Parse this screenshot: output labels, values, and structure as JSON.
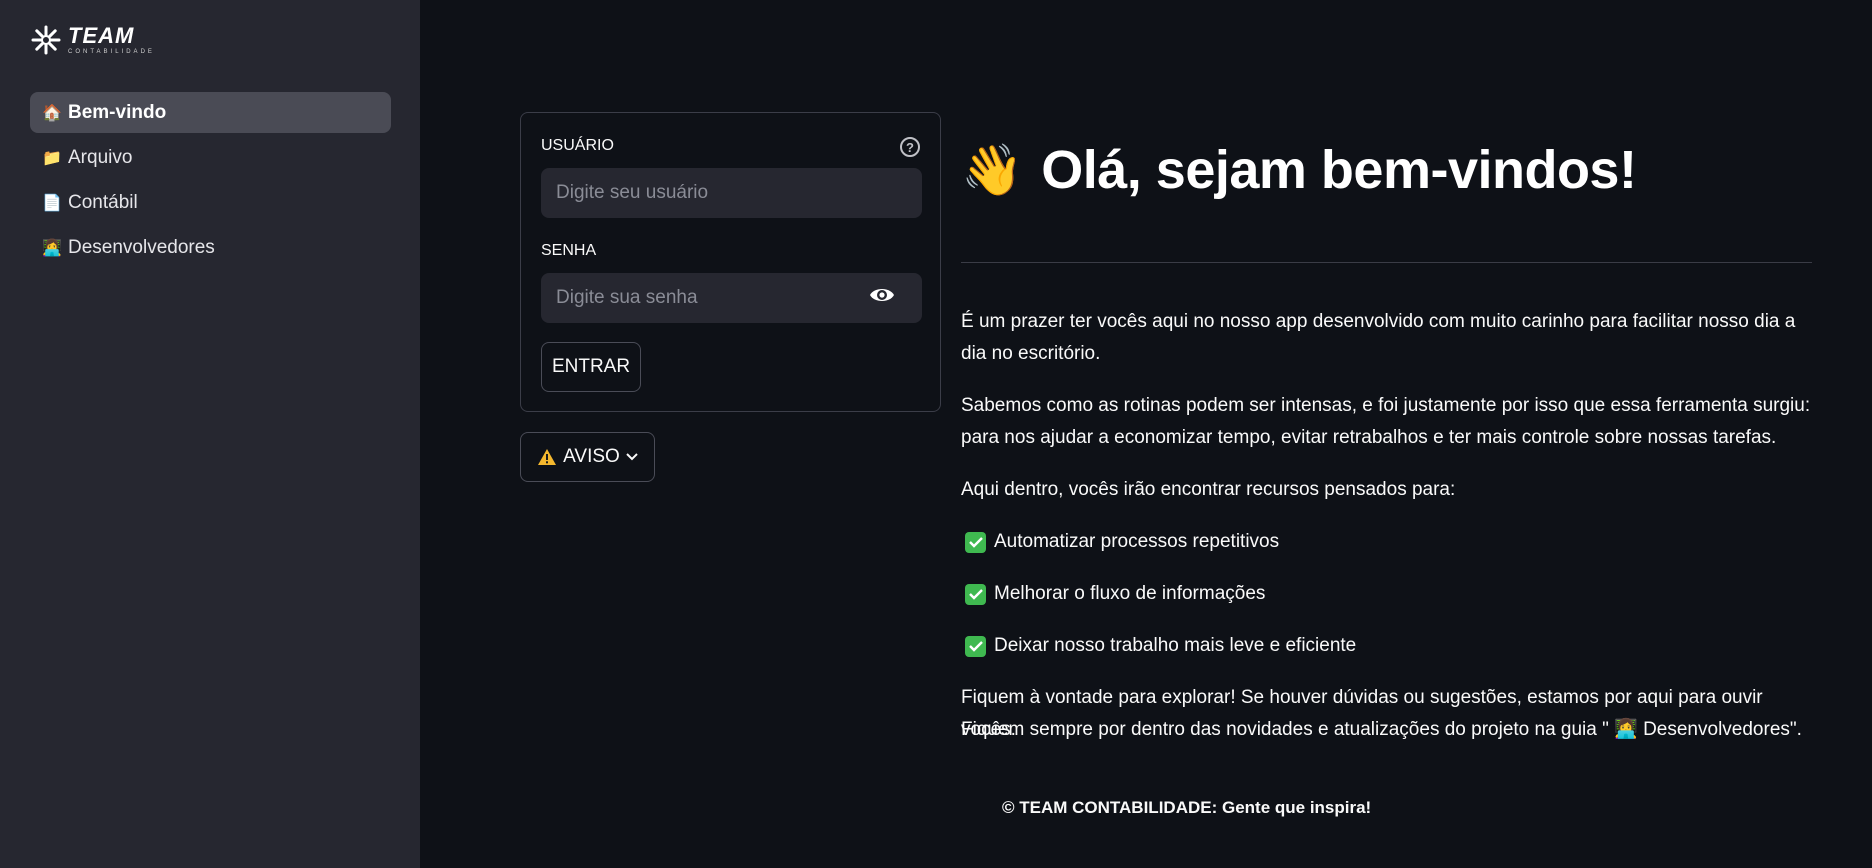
{
  "sidebar": {
    "logo": {
      "title": "TEAM",
      "subtitle": "CONTABILIDADE"
    },
    "items": [
      {
        "emoji": "🏠",
        "label": "Bem-vindo",
        "active": true
      },
      {
        "emoji": "📁",
        "label": "Arquivo",
        "active": false
      },
      {
        "emoji": "📄",
        "label": "Contábil",
        "active": false
      },
      {
        "emoji": "👩‍💻",
        "label": "Desenvolvedores",
        "active": false
      }
    ]
  },
  "login": {
    "user_label": "USUÁRIO",
    "user_placeholder": "Digite seu usuário",
    "user_value": "",
    "password_label": "SENHA",
    "password_placeholder": "Digite sua senha",
    "password_value": "",
    "submit_label": "ENTRAR"
  },
  "aviso": {
    "label": "AVISO"
  },
  "main": {
    "wave_emoji": "👋",
    "title": "Olá, sejam bem-vindos!",
    "paragraph1": "É um prazer ter vocês aqui no nosso app desenvolvido com muito carinho para facilitar nosso dia a dia no escritório.",
    "paragraph2": "Sabemos como as rotinas podem ser intensas, e foi justamente por isso que essa ferramenta surgiu: para nos ajudar a economizar tempo, evitar retrabalhos e ter mais controle sobre nossas tarefas.",
    "paragraph3": "Aqui dentro, vocês irão encontrar recursos pensados para:",
    "features": [
      "Automatizar processos repetitivos",
      "Melhorar o fluxo de informações",
      "Deixar nosso trabalho mais leve e eficiente"
    ],
    "closing_line1": "Fiquem à vontade para explorar! Se houver dúvidas ou sugestões, estamos por aqui para ouvir vocês.",
    "closing_line2": "Fiquem sempre por dentro das novidades e atualizações do projeto na guia \" 👩‍💻 Desenvolvedores\"."
  },
  "footer": {
    "text": "© TEAM CONTABILIDADE: Gente que inspira!"
  },
  "colors": {
    "sidebar_bg": "#262730",
    "page_bg": "#0e1117",
    "check_green": "#3fb950",
    "warn_yellow": "#f5b82e"
  }
}
